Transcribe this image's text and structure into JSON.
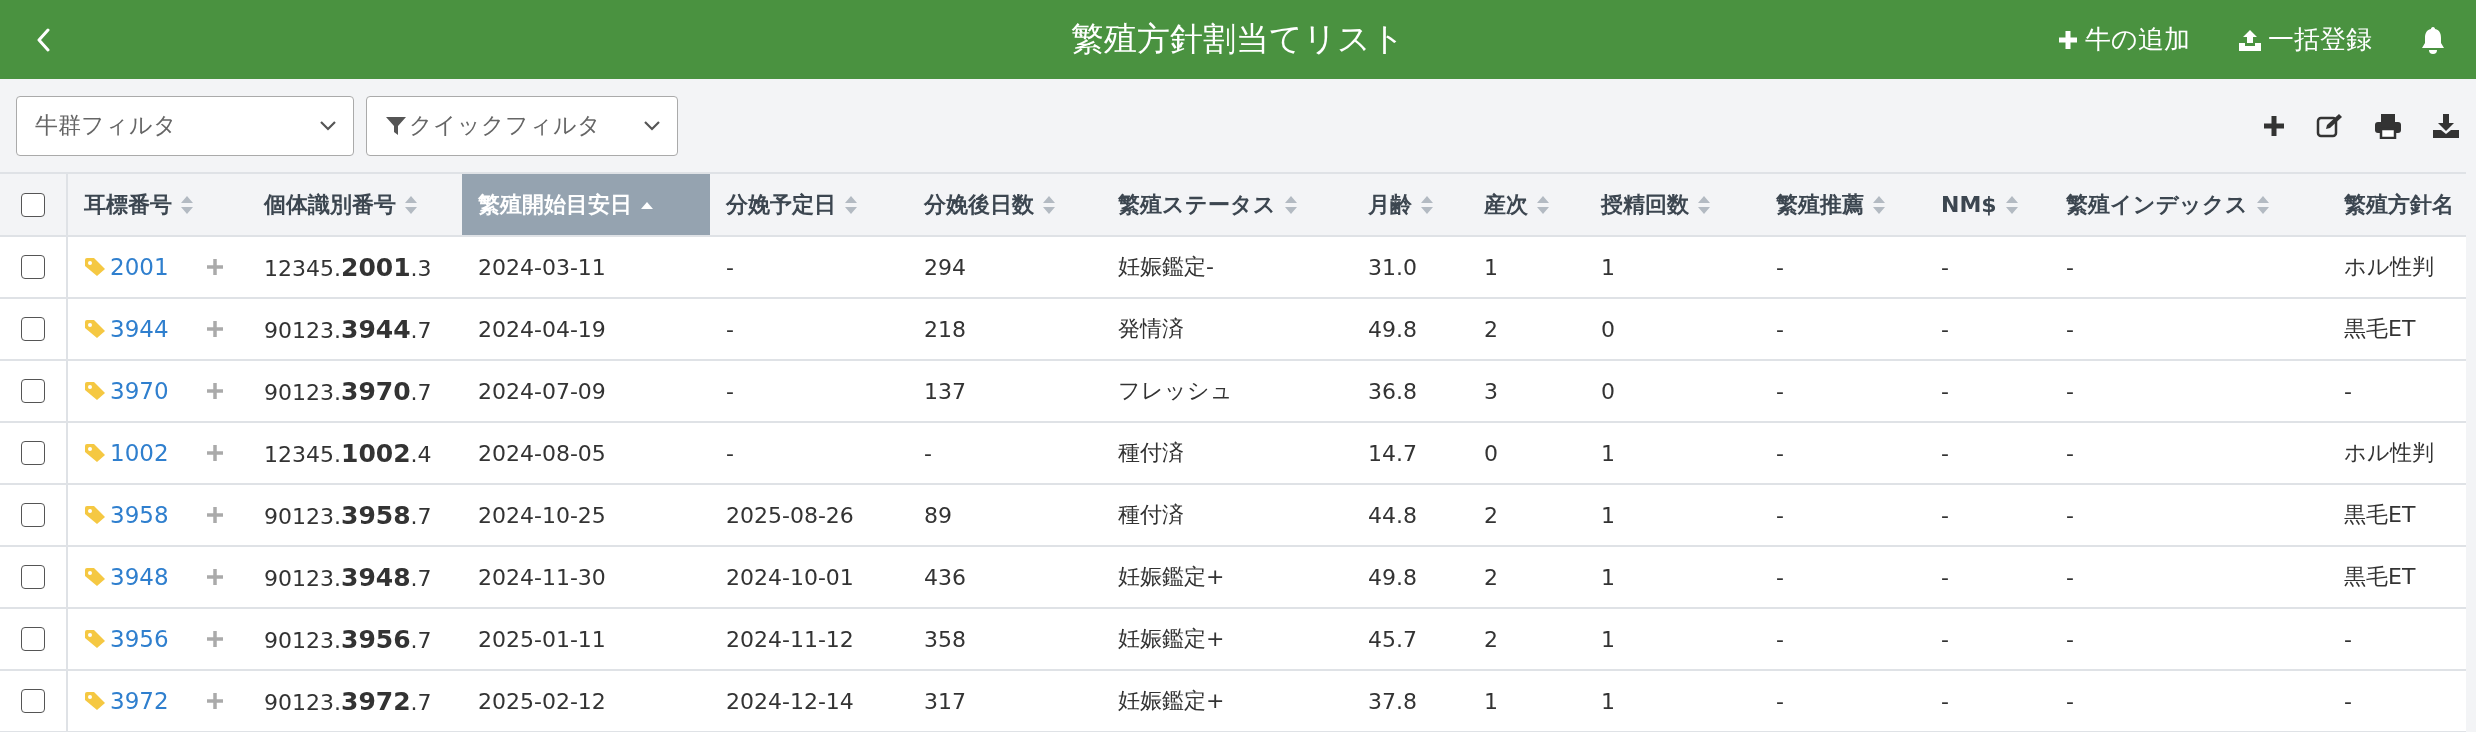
{
  "header": {
    "title": "繁殖方針割当てリスト",
    "actions": [
      {
        "kind": "add",
        "label": "牛の追加"
      },
      {
        "kind": "upload",
        "label": "一括登録"
      },
      {
        "kind": "bell"
      }
    ]
  },
  "filters": [
    {
      "kind": "plain",
      "label": "牛群フィルタ"
    },
    {
      "kind": "funnel",
      "label": "クイックフィルタ"
    }
  ],
  "table": {
    "select_all_checked": false,
    "columns": [
      {
        "label": "耳標番号",
        "sorted": false
      },
      {
        "label": "個体識別番号",
        "sorted": false
      },
      {
        "label": "繁殖開始目安日",
        "sorted": true
      },
      {
        "label": "分娩予定日",
        "sorted": false
      },
      {
        "label": "分娩後日数",
        "sorted": false
      },
      {
        "label": "繁殖ステータス",
        "sorted": false
      },
      {
        "label": "月齢",
        "sorted": false
      },
      {
        "label": "産次",
        "sorted": false
      },
      {
        "label": "授精回数",
        "sorted": false
      },
      {
        "label": "繁殖推薦",
        "sorted": false
      },
      {
        "label": "NM$",
        "sorted": false
      },
      {
        "label": "繁殖インデックス",
        "sorted": false
      },
      {
        "label": "繁殖方針名",
        "sorted": false
      }
    ],
    "rows": [
      {
        "checked": false,
        "cells": [
          "2001",
          "12345.**2001**.3",
          "2024-03-11",
          "-",
          "294",
          "妊娠鑑定-",
          "31.0",
          "1",
          "1",
          "-",
          "-",
          "-",
          "ホル性判"
        ]
      },
      {
        "checked": false,
        "cells": [
          "3944",
          "90123.**3944**.7",
          "2024-04-19",
          "-",
          "218",
          "発情済",
          "49.8",
          "2",
          "0",
          "-",
          "-",
          "-",
          "黒毛ET"
        ]
      },
      {
        "checked": false,
        "cells": [
          "3970",
          "90123.**3970**.7",
          "2024-07-09",
          "-",
          "137",
          "フレッシュ",
          "36.8",
          "3",
          "0",
          "-",
          "-",
          "-",
          "-"
        ]
      },
      {
        "checked": false,
        "cells": [
          "1002",
          "12345.**1002**.4",
          "2024-08-05",
          "-",
          "-",
          "種付済",
          "14.7",
          "0",
          "1",
          "-",
          "-",
          "-",
          "ホル性判"
        ]
      },
      {
        "checked": false,
        "cells": [
          "3958",
          "90123.**3958**.7",
          "2024-10-25",
          "2025-08-26",
          "89",
          "種付済",
          "44.8",
          "2",
          "1",
          "-",
          "-",
          "-",
          "黒毛ET"
        ]
      },
      {
        "checked": false,
        "cells": [
          "3948",
          "90123.**3948**.7",
          "2024-11-30",
          "2024-10-01",
          "436",
          "妊娠鑑定+",
          "49.8",
          "2",
          "1",
          "-",
          "-",
          "-",
          "黒毛ET"
        ]
      },
      {
        "checked": false,
        "cells": [
          "3956",
          "90123.**3956**.7",
          "2025-01-11",
          "2024-11-12",
          "358",
          "妊娠鑑定+",
          "45.7",
          "2",
          "1",
          "-",
          "-",
          "-",
          "-"
        ]
      },
      {
        "checked": false,
        "cells": [
          "3972",
          "90123.**3972**.7",
          "2025-02-12",
          "2024-12-14",
          "317",
          "妊娠鑑定+",
          "37.8",
          "1",
          "1",
          "-",
          "-",
          "-",
          "-"
        ]
      }
    ]
  }
}
